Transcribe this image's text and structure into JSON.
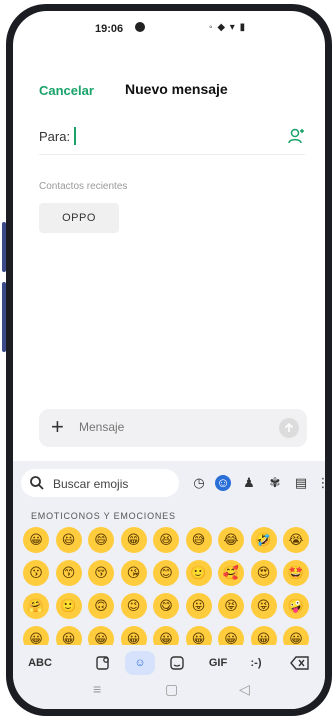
{
  "status_bar": {
    "time": "19:06",
    "icons": "◦ ◆ ▾ ▮"
  },
  "header": {
    "cancel_label": "Cancelar",
    "title": "Nuevo mensaje"
  },
  "recipient": {
    "label": "Para:",
    "value": ""
  },
  "recent": {
    "label": "Contactos recientes",
    "contacts": [
      "OPPO"
    ]
  },
  "compose": {
    "placeholder": "Mensaje"
  },
  "keyboard": {
    "search_placeholder": "Buscar emojis",
    "category_icons": [
      "clock-icon",
      "smiley-icon",
      "person-icon",
      "pet-icon",
      "food-icon",
      "more-icon"
    ],
    "section_label": "EMOTICONOS Y EMOCIONES",
    "emoji_rows": [
      [
        "😀",
        "😃",
        "😄",
        "😁",
        "😆",
        "😅",
        "😂",
        "🤣",
        "😭"
      ],
      [
        "😗",
        "😙",
        "😚",
        "😘",
        "😊",
        "🙂",
        "🥰",
        "😍",
        "🤩"
      ],
      [
        "🤗",
        "🙂",
        "🙃",
        "😉",
        "😋",
        "😛",
        "😝",
        "😜",
        "🤪"
      ],
      [
        "😀",
        "😀",
        "😀",
        "😀",
        "😀",
        "😀",
        "😀",
        "😀",
        "😀"
      ]
    ],
    "bottom_bar": {
      "abc_label": "ABC",
      "gif_label": "GIF",
      "emoticon_label": ":-)"
    }
  },
  "colors": {
    "accent": "#19a36a",
    "keyboard_bg": "#eef0f5",
    "active_tab": "#2a6fd8"
  }
}
